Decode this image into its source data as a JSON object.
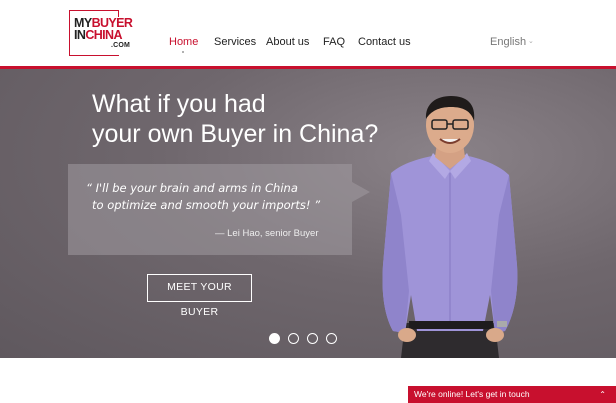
{
  "logo": {
    "line1_a": "MY",
    "line1_b": "BUYER",
    "line2_a": "IN",
    "line2_b": "CHINA",
    "line3": ".COM"
  },
  "nav": {
    "items": [
      {
        "label": "Home",
        "active": true
      },
      {
        "label": "Services",
        "active": false
      },
      {
        "label": "About us",
        "active": false
      },
      {
        "label": "FAQ",
        "active": false
      },
      {
        "label": "Contact us",
        "active": false
      }
    ]
  },
  "language": {
    "selected": "English",
    "caret": "⌄"
  },
  "hero": {
    "headline_line1": "What if you had",
    "headline_line2": "your own Buyer in China?",
    "quote_line1": "“ I'll be your brain and arms in China",
    "quote_line2": "to optimize and smooth your imports! ”",
    "quote_author": "— Lei Hao, senior Buyer",
    "cta_label": "MEET YOUR BUYER",
    "slides": {
      "count": 4,
      "active_index": 0
    }
  },
  "chat": {
    "label": "We're online! Let's get in touch",
    "caret": "⌃"
  },
  "colors": {
    "brand_red": "#c8102e",
    "hero_bg": "#6f676d",
    "shirt": "#9f94d8"
  },
  "icons": {
    "language_caret": "chevron-down-icon",
    "chat_caret": "chevron-up-icon"
  }
}
